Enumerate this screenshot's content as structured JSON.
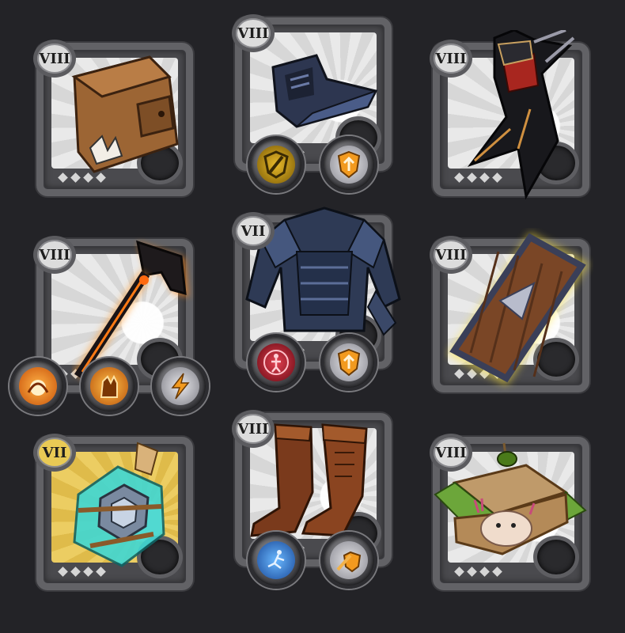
{
  "slots": [
    {
      "tier": "VIII",
      "item": "bag",
      "quality": "silver"
    },
    {
      "tier": "VIII",
      "item": "helmet",
      "quality": "silver"
    },
    {
      "tier": "VIII",
      "item": "cape",
      "quality": "silver"
    },
    {
      "tier": "VIII",
      "item": "fire-staff",
      "quality": "silver"
    },
    {
      "tier": "VII",
      "item": "armor",
      "quality": "silver"
    },
    {
      "tier": "VIII",
      "item": "shield",
      "quality": "silver"
    },
    {
      "tier": "VII",
      "item": "potion",
      "quality": "gold"
    },
    {
      "tier": "VIII",
      "item": "boots",
      "quality": "silver"
    },
    {
      "tier": "VIII",
      "item": "sandwich",
      "quality": "silver"
    }
  ],
  "spell_icons": {
    "helmet": [
      "sword-shield-icon",
      "shield-orange-icon"
    ],
    "fire-staff": [
      "fire-blast-icon",
      "flame-fist-icon",
      "lightning-icon"
    ],
    "armor": [
      "figure-red-icon",
      "shield-orange-icon"
    ],
    "boots": [
      "dash-icon",
      "sword-shield-orange-icon"
    ]
  },
  "colors": {
    "background": "#232327",
    "frame": "#626266",
    "gold_face": "#e6c454",
    "silver_face": "#e0e0e0"
  }
}
